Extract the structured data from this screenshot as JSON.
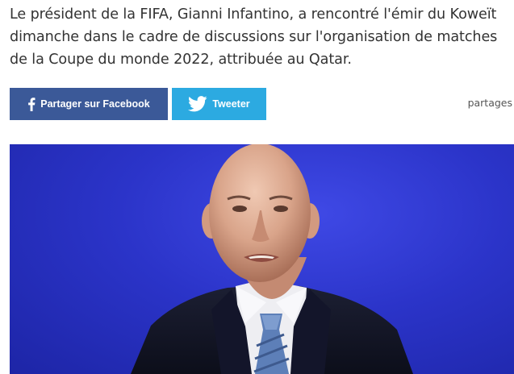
{
  "article": {
    "intro": "Le président de la FIFA, Gianni Infantino, a rencontré l'émir du Koweït dimanche dans le cadre de discussions sur l'organisation de matches de la Coupe du monde 2022, attribuée au Qatar."
  },
  "share": {
    "facebook_label": "Partager sur Facebook",
    "facebook_icon": "facebook-f-icon",
    "facebook_color": "#3b5998",
    "twitter_label": "Tweeter",
    "twitter_icon": "twitter-bird-icon",
    "twitter_color": "#2caae1",
    "shares_label": "partages"
  },
  "photo": {
    "subject": "photo of a bald man in a dark suit, white shirt and blue striped tie against a blue background",
    "background_color": "#2b34c9"
  }
}
